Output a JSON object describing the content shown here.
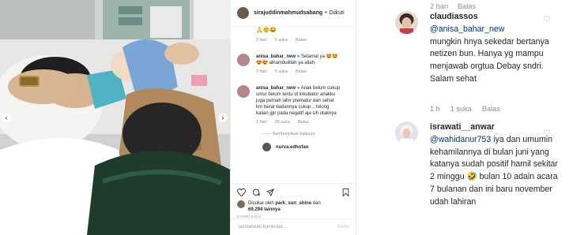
{
  "post": {
    "username": "sirajuddinmahmudsabang",
    "separator": "•",
    "follow_status": "Diikuti",
    "top_emoji_line": "🙏🙂😂",
    "top_meta": {
      "time": "2 hari",
      "likes": "6 suka",
      "reply": "Balas"
    },
    "comments": [
      {
        "user": "anisa_bahar_new",
        "text": "Selamat ya 🤩🤩😍😍 alhamdulillah ya allah",
        "time": "2 hari",
        "likes": "5 suka",
        "reply": "Balas"
      },
      {
        "user": "anisa_bahar_new",
        "text": "Anak belum cukup umur belum tentu di inkubator anakku juga pernah lahir prematur dan sehat krn berat badannya cukup .. tolong kalian jgn pada negatif aja sih otaknya",
        "time": "2 hari",
        "likes": "26 suka",
        "reply": "Balas"
      }
    ],
    "hide_replies": "Sembunyikan balasan",
    "reply_peek_user": "nurva.edhofan",
    "likes": {
      "prefix": "Disukai oleh",
      "first_user": "park_sun_shine",
      "and": "dan",
      "count": "69.294 lainnya"
    },
    "time_ago": "2 HARI LALU",
    "add_comment_placeholder": "Tambahkan komentar...",
    "post_button": "Kirim",
    "icons": [
      "heart-icon",
      "comment-icon",
      "share-icon",
      "bookmark-icon",
      "chevron-left-icon",
      "chevron-right-icon"
    ]
  },
  "zoom": {
    "top_meta": {
      "time": "2 hari",
      "reply": "Balas"
    },
    "comments": [
      {
        "user": "claudiassos",
        "mention": "@anisa_bahar_new",
        "text": "mungkin hnya sekedar bertanya netizen bun. Hanya yg mampu menjawab orgtua Debay sndri. Salam sehat",
        "time": "1 h",
        "likes": "1 suka",
        "reply": "Balas"
      },
      {
        "user": "israwati__anwar",
        "mention": "@wahidanur753",
        "text": "iya dan umumin kehamilannya di bulan juni yang katanya sudah positif hamil sekitar 2 minggu 🤣 bulan 10 adain acara 7 bulanan dan ini baru november udah lahiran"
      }
    ]
  },
  "colors": {
    "link": "#003569",
    "muted": "#8e8e8e",
    "text": "#262626",
    "border": "#efefef",
    "post_button": "#b2dffc"
  }
}
